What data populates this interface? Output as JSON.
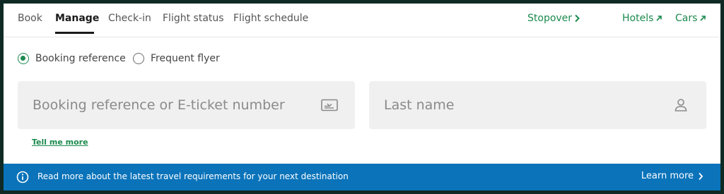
{
  "nav": {
    "tabs": [
      {
        "label": "Book",
        "active": false
      },
      {
        "label": "Manage",
        "active": true
      },
      {
        "label": "Check-in",
        "active": false
      },
      {
        "label": "Flight status",
        "active": false
      },
      {
        "label": "Flight schedule",
        "active": false
      }
    ],
    "external": [
      {
        "label": "Stopover",
        "icon": "chevron-right-icon"
      },
      {
        "label": "Hotels",
        "icon": "arrow-up-right-icon"
      },
      {
        "label": "Cars",
        "icon": "arrow-up-right-icon"
      }
    ]
  },
  "search_type": {
    "options": [
      {
        "label": "Booking reference",
        "selected": true
      },
      {
        "label": "Frequent flyer",
        "selected": false
      }
    ]
  },
  "form": {
    "booking": {
      "placeholder": "Booking reference or E-ticket number",
      "value": "",
      "icon": "ticket-icon"
    },
    "lastname": {
      "placeholder": "Last name",
      "value": "",
      "icon": "person-icon"
    },
    "help_link": "Tell me more"
  },
  "banner": {
    "icon": "info-icon",
    "message": "Read more about the latest travel requirements for your next destination",
    "link_label": "Learn more"
  },
  "colors": {
    "accent": "#1c8a4e",
    "banner": "#0a73ba",
    "field_bg": "#f0f0f0",
    "frame": "#0f2a24"
  }
}
